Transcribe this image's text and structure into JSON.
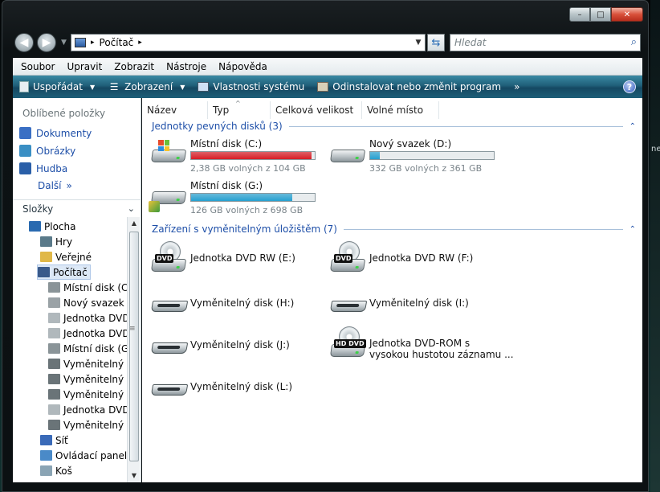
{
  "window": {
    "caption_buttons": {
      "minimize": "–",
      "maximize": "□",
      "close": "✕"
    }
  },
  "address": {
    "crumb_root_sep": "▸",
    "location": "Počítač",
    "trail_sep": "▸",
    "search_placeholder": "Hledat"
  },
  "menubar": {
    "items": [
      "Soubor",
      "Upravit",
      "Zobrazit",
      "Nástroje",
      "Nápověda"
    ]
  },
  "commandbar": {
    "organize": "Uspořádat",
    "views": "Zobrazení",
    "system_properties": "Vlastnosti systému",
    "uninstall": "Odinstalovat nebo změnit program",
    "more": "»",
    "help": "?"
  },
  "navpane": {
    "favorites_title": "Oblíbené položky",
    "favorites": [
      {
        "label": "Dokumenty",
        "color": "#3a6fc4"
      },
      {
        "label": "Obrázky",
        "color": "#3a8fc4"
      },
      {
        "label": "Hudba",
        "color": "#2a5fa8"
      }
    ],
    "more_label": "Další",
    "more_chev": "»",
    "folders_title": "Složky",
    "tree": [
      {
        "label": "Plocha",
        "color": "#2a6ab0"
      },
      {
        "label": "Hry",
        "color": "#5a7a8a"
      },
      {
        "label": "Veřejné",
        "color": "#e0b848"
      },
      {
        "label": "Počítač",
        "color": "#3a5a8a",
        "selected": true
      },
      {
        "label": "Místní disk (C:)",
        "color": "#8a9498"
      },
      {
        "label": "Nový svazek (D",
        "color": "#9aa2a6"
      },
      {
        "label": "Jednotka DVD",
        "color": "#b0b8bc"
      },
      {
        "label": "Jednotka DVD",
        "color": "#b0b8bc"
      },
      {
        "label": "Místní disk (G:)",
        "color": "#8a9498"
      },
      {
        "label": "Vyměnitelný d",
        "color": "#6a7478"
      },
      {
        "label": "Vyměnitelný d",
        "color": "#6a7478"
      },
      {
        "label": "Vyměnitelný d",
        "color": "#6a7478"
      },
      {
        "label": "Jednotka DVD-",
        "color": "#b0b8bc"
      },
      {
        "label": "Vyměnitelný d",
        "color": "#6a7478"
      },
      {
        "label": "Síť",
        "color": "#3a6ab8"
      },
      {
        "label": "Ovládací panely",
        "color": "#4a8ac8"
      },
      {
        "label": "Koš",
        "color": "#8aa4b4"
      }
    ]
  },
  "columns": [
    "Název",
    "Typ",
    "Celková velikost",
    "Volné místo"
  ],
  "sort_indicator": "^",
  "groups": {
    "hdd": {
      "title": "Jednotky pevných disků (3)"
    },
    "removable": {
      "title": "Zařízení s vyměnitelným úložištěm (7)"
    }
  },
  "drives": [
    {
      "name": "Místní disk (C:)",
      "sub": "2,38 GB volných z 104 GB",
      "used_fraction": 0.977,
      "bar_color": "#d81c24"
    },
    {
      "name": "Nový svazek (D:)",
      "sub": "332 GB volných z 361 GB",
      "used_fraction": 0.08,
      "bar_color": "#26a0d0"
    },
    {
      "name": "Místní disk (G:)",
      "sub": "126 GB volných z 698 GB",
      "used_fraction": 0.82,
      "bar_color": "#26a0d0"
    }
  ],
  "devices": [
    {
      "name": "Jednotka DVD RW (E:)",
      "kind": "dvd",
      "badge": "DVD"
    },
    {
      "name": "Jednotka DVD RW (F:)",
      "kind": "dvd",
      "badge": "DVD"
    },
    {
      "name": "Vyměnitelný disk (H:)",
      "kind": "removable"
    },
    {
      "name": "Vyměnitelný disk (I:)",
      "kind": "removable"
    },
    {
      "name": "Vyměnitelný disk (J:)",
      "kind": "removable"
    },
    {
      "name": "Jednotka DVD-ROM s\nvysokou hustotou záznamu ...",
      "kind": "dvd",
      "badge": "HD DVD"
    },
    {
      "name": "Vyměnitelný disk (L:)",
      "kind": "removable"
    }
  ],
  "edge": {
    "fragment": "ne"
  }
}
